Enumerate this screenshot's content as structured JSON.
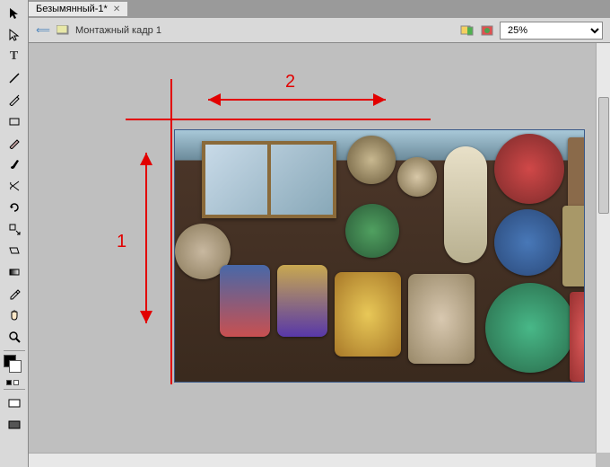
{
  "document": {
    "tab_title": "Безымянный-1*",
    "frame_title": "Монтажный кадр 1"
  },
  "toolbar": {
    "zoom": "25%"
  },
  "annotations": {
    "horizontal_label": "2",
    "vertical_label": "1"
  },
  "colors": {
    "guide": "#e20000",
    "panel": "#d9d9d9",
    "canvas_bg": "#bfbfbf"
  }
}
